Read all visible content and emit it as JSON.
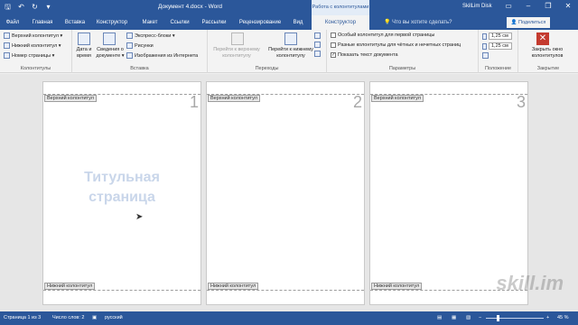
{
  "window": {
    "title": "Документ 4.docx  -  Word",
    "context_header": "Работа с колонтитулами",
    "user": "SkilLim Disk",
    "minimize_icon": "minimize-icon",
    "restore_icon": "restore-icon",
    "close_icon": "close-icon"
  },
  "tabs": {
    "file": "Файл",
    "items": [
      "Главная",
      "Вставка",
      "Конструктор",
      "Макет",
      "Ссылки",
      "Рассылки",
      "Рецензирование",
      "Вид",
      "Конструктор"
    ],
    "active_index": 8,
    "tell_me": "Что вы хотите сделать?",
    "share": "Поделиться"
  },
  "ribbon": {
    "header_footer": {
      "header": "Верхний колонтитул ▾",
      "footer": "Нижний колонтитул ▾",
      "page_number": "Номер страницы ▾",
      "label": "Колонтитулы"
    },
    "insert": {
      "date_time_1": "Дата и",
      "date_time_2": "время",
      "doc_info_1": "Сведения о",
      "doc_info_2": "документе ▾",
      "quick_parts": "Экспресс-блоки ▾",
      "pictures": "Рисунки",
      "online_pictures": "Изображения из Интернета",
      "label": "Вставка"
    },
    "navigation": {
      "goto_header_1": "Перейти к верхнему",
      "goto_header_2": "колонтитулу",
      "goto_footer_1": "Перейти к нижнему",
      "goto_footer_2": "колонтитулу",
      "label": "Переходы"
    },
    "options": {
      "different_first": "Особый колонтитул для первой страницы",
      "odd_even": "Разные колонтитулы для чётных и нечетных страниц",
      "show_text": "Показать текст документа",
      "checked_show_text": "✓",
      "label": "Параметры"
    },
    "position": {
      "header_from_top": "1,25 см",
      "footer_from_bottom": "1,25 см",
      "label": "Положение"
    },
    "close": {
      "button_1": "Закрыть окно",
      "button_2": "колонтитулов",
      "label": "Закрытие"
    }
  },
  "pages": [
    {
      "number": "1",
      "header_label": "Верхний колонтитул",
      "footer_label": "Нижний колонтитул",
      "body_line1": "Титульная",
      "body_line2": "страница"
    },
    {
      "number": "2",
      "header_label": "Верхний колонтитул",
      "footer_label": "Нижний колонтитул"
    },
    {
      "number": "3",
      "header_label": "Верхний колонтитул",
      "footer_label": "Нижний колонтитул"
    }
  ],
  "watermark": "skill.im",
  "status": {
    "pages": "Страница 1 из 3",
    "words": "Число слов: 2",
    "language": "русский",
    "zoom": "45 %",
    "zoom_fraction": 0.45
  },
  "colors": {
    "accent": "#2b579a",
    "close_red": "#c43b2f"
  }
}
